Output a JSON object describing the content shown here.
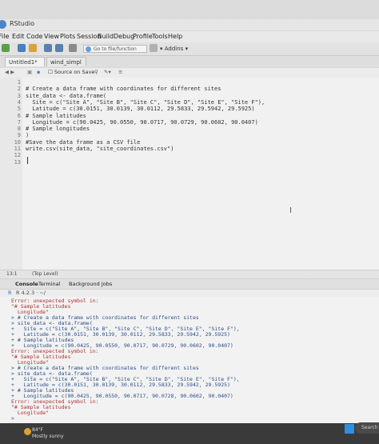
{
  "window": {
    "title": "RStudio"
  },
  "menu": [
    "File",
    "Edit",
    "Code",
    "View",
    "Plots",
    "Session",
    "Build",
    "Debug",
    "Profile",
    "Tools",
    "Help"
  ],
  "toolbar": {
    "goto_placeholder": "Go to file/function",
    "addins_label": "Addins"
  },
  "tabs": [
    {
      "label": "Untitled1*"
    },
    {
      "label": "wind_simpl"
    }
  ],
  "editor_toolbar": {
    "source_on_save": "Source on Save"
  },
  "editor": {
    "lines": [
      {
        "n": "1",
        "text": ""
      },
      {
        "n": "2",
        "text": "# Create a data frame with coordinates for different sites"
      },
      {
        "n": "3",
        "text": "site_data <- data.frame("
      },
      {
        "n": "4",
        "text": "  Site = c(\"Site A\", \"Site B\", \"Site C\", \"Site D\", \"Site E\", \"Site F\"),"
      },
      {
        "n": "5",
        "text": "  Latitude = c(30.0151, 30.0139, 30.0112, 29.5833, 29.5942, 29.5925)"
      },
      {
        "n": "6",
        "text": "# Sample latitudes"
      },
      {
        "n": "7",
        "text": "  Longitude = c(90.0425, 90.0550, 90.0717, 90.0729, 90.0602, 90.0407)"
      },
      {
        "n": "8",
        "text": "# Sample longitudes"
      },
      {
        "n": "9",
        "text": ")"
      },
      {
        "n": "10",
        "text": "#Save the data frame as a CSV file"
      },
      {
        "n": "11",
        "text": "write.csv(site_data, \"site_coordinates.csv\")"
      },
      {
        "n": "12",
        "text": ""
      },
      {
        "n": "13",
        "text": ""
      }
    ]
  },
  "status": {
    "position": "13:1",
    "scope": "(Top Level)"
  },
  "console_tabs": [
    "Console",
    "Terminal",
    "Background Jobs"
  ],
  "console_header": "R 4.2.3 · ~/",
  "console": {
    "lines": [
      {
        "text": "Error: unexpected symbol in:",
        "type": "err"
      },
      {
        "text": "\"# Sample latitudes",
        "type": "err"
      },
      {
        "text": "  Longitude\"",
        "type": "err"
      },
      {
        "text": "> # Create a data frame with coordinates for different sites",
        "type": "in"
      },
      {
        "text": "> site_data <- data.frame(",
        "type": "in"
      },
      {
        "text": "+   Site = c(\"Site A\", \"Site B\", \"Site C\", \"Site D\", \"Site E\", \"Site F\"),",
        "type": "in"
      },
      {
        "text": "+   Latitude = c(30.0151, 30.0139, 30.0112, 29.5833, 29.5942, 29.5925)",
        "type": "in"
      },
      {
        "text": "+ # Sample latitudes",
        "type": "in"
      },
      {
        "text": "+   Longitude = c(90.0425, 90.0550, 90.0717, 90.0729, 90.0602, 90.0407)",
        "type": "in"
      },
      {
        "text": "Error: unexpected symbol in:",
        "type": "err"
      },
      {
        "text": "\"# Sample latitudes",
        "type": "err"
      },
      {
        "text": "  Longitude\"",
        "type": "err"
      },
      {
        "text": "> # Create a data frame with coordinates for different sites",
        "type": "in"
      },
      {
        "text": "> site_data <- data.frame(",
        "type": "in"
      },
      {
        "text": "+   Site = c(\"Site A\", \"Site B\", \"Site C\", \"Site D\", \"Site E\", \"Site F\"),",
        "type": "in"
      },
      {
        "text": "+   Latitude = c(30.0151, 30.0139, 30.0112, 29.5833, 29.5942, 29.5925)",
        "type": "in"
      },
      {
        "text": "+ # Sample latitudes",
        "type": "in"
      },
      {
        "text": "+   Longitude = c(90.0425, 90.0550, 90.0717, 90.0728, 90.0602, 90.0407)",
        "type": "in"
      },
      {
        "text": "Error: unexpected symbol in:",
        "type": "err"
      },
      {
        "text": "\"# Sample latitudes",
        "type": "err"
      },
      {
        "text": "  Longitude\"",
        "type": "err"
      },
      {
        "text": ">",
        "type": "in"
      }
    ]
  },
  "taskbar": {
    "temp": "84°F",
    "condition": "Mostly sunny",
    "search": "Search"
  }
}
